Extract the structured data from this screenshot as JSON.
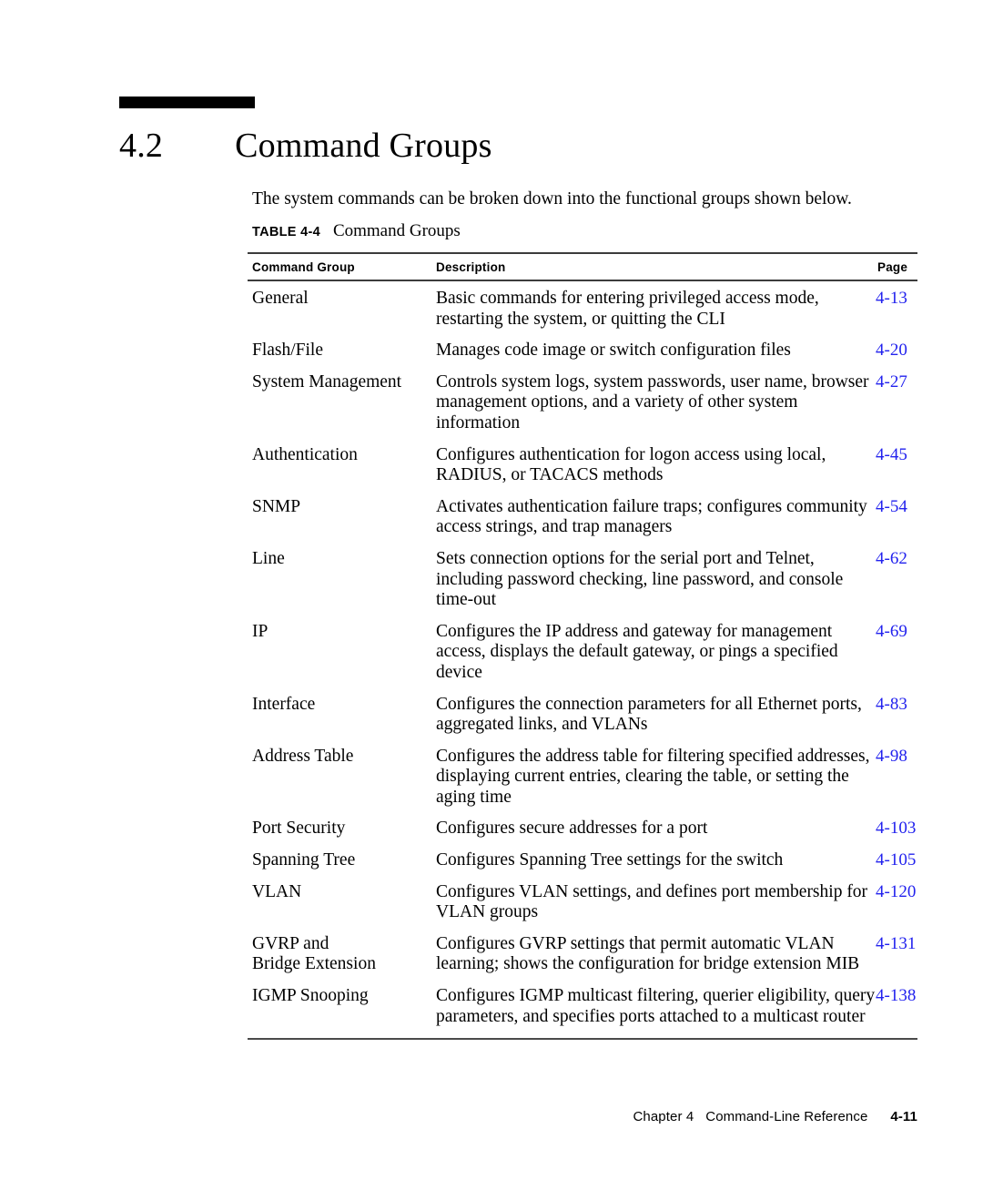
{
  "section": {
    "number": "4.2",
    "title": "Command Groups"
  },
  "intro": "The system commands can be broken down into the functional groups shown below.",
  "table_caption": {
    "label": "TABLE 4-4",
    "title": "Command Groups"
  },
  "colors": {
    "page_link": "#2222ee",
    "rule": "#3c3c3c",
    "text": "#000000"
  },
  "table": {
    "headers": {
      "group": "Command Group",
      "description": "Description",
      "page": "Page"
    },
    "rows": [
      {
        "group_lines": [
          "General"
        ],
        "desc_lines": [
          "Basic commands for entering privileged access mode,",
          "restarting the system, or quitting the CLI"
        ],
        "page": "4-13"
      },
      {
        "group_lines": [
          "Flash/File"
        ],
        "desc_lines": [
          "Manages code image or switch configuration files"
        ],
        "page": "4-20"
      },
      {
        "group_lines": [
          "System Management"
        ],
        "desc_lines": [
          "Controls system logs, system passwords, user name, browser",
          "management options, and a variety of other system",
          "information"
        ],
        "page": "4-27"
      },
      {
        "group_lines": [
          "Authentication"
        ],
        "desc_lines": [
          "Configures authentication for logon access using local,",
          "RADIUS, or TACACS methods"
        ],
        "page": "4-45"
      },
      {
        "group_lines": [
          "SNMP"
        ],
        "desc_lines": [
          "Activates authentication failure traps; configures community",
          "access strings, and trap managers"
        ],
        "page": "4-54"
      },
      {
        "group_lines": [
          "Line"
        ],
        "desc_lines": [
          "Sets connection options for the serial port and Telnet,",
          "including password checking, line password, and console",
          "time-out"
        ],
        "page": "4-62"
      },
      {
        "group_lines": [
          "IP"
        ],
        "desc_lines": [
          "Configures the IP address and gateway for management",
          "access, displays the default gateway, or pings a specified",
          "device"
        ],
        "page": "4-69"
      },
      {
        "group_lines": [
          "Interface"
        ],
        "desc_lines": [
          "Configures the connection parameters for all Ethernet ports,",
          "aggregated links, and VLANs"
        ],
        "page": "4-83"
      },
      {
        "group_lines": [
          "Address Table"
        ],
        "desc_lines": [
          "Configures the address table for filtering specified addresses,",
          "displaying current entries, clearing the table, or setting the",
          "aging time"
        ],
        "page": "4-98"
      },
      {
        "group_lines": [
          "Port Security"
        ],
        "desc_lines": [
          "Configures secure addresses for a port"
        ],
        "page": "4-103"
      },
      {
        "group_lines": [
          "Spanning Tree"
        ],
        "desc_lines": [
          "Configures Spanning Tree settings for the switch"
        ],
        "page": "4-105"
      },
      {
        "group_lines": [
          "VLAN"
        ],
        "desc_lines": [
          "Configures VLAN settings, and defines port membership for",
          "VLAN groups"
        ],
        "page": "4-120"
      },
      {
        "group_lines": [
          "GVRP and",
          "Bridge Extension"
        ],
        "desc_lines": [
          "Configures GVRP settings that permit automatic VLAN",
          "learning; shows the configuration for bridge extension MIB"
        ],
        "page": "4-131"
      },
      {
        "group_lines": [
          "IGMP Snooping"
        ],
        "desc_lines": [
          "Configures IGMP multicast filtering, querier eligibility, query",
          "parameters, and specifies ports attached to a multicast router"
        ],
        "page": "4-138"
      }
    ]
  },
  "footer": {
    "chapter": "Chapter 4",
    "chapter_title": "Command-Line Reference",
    "page_number": "4-11"
  }
}
